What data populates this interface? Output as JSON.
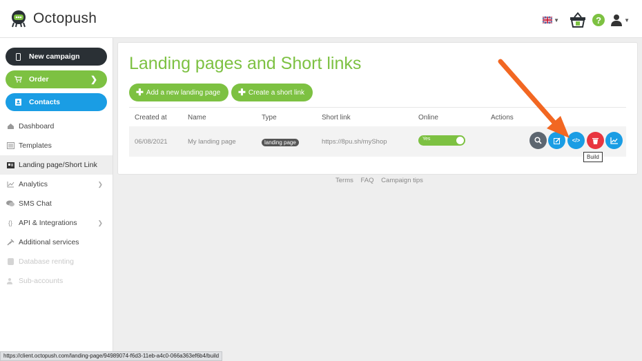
{
  "app": {
    "name": "Octopush"
  },
  "header": {
    "flag": "uk-flag",
    "basket_count": "0"
  },
  "sidebar": {
    "buttons": [
      {
        "label": "New campaign",
        "icon": "phone-icon"
      },
      {
        "label": "Order",
        "icon": "cart-icon"
      },
      {
        "label": "Contacts",
        "icon": "address-book-icon"
      }
    ],
    "items": [
      {
        "label": "Dashboard",
        "icon": "dashboard-icon"
      },
      {
        "label": "Templates",
        "icon": "template-icon"
      },
      {
        "label": "Landing page/Short Link",
        "icon": "landing-icon"
      },
      {
        "label": "Analytics",
        "icon": "chart-icon"
      },
      {
        "label": "SMS Chat",
        "icon": "chat-icon"
      },
      {
        "label": "API & Integrations",
        "icon": "code-icon"
      },
      {
        "label": "Additional services",
        "icon": "tools-icon"
      },
      {
        "label": "Database renting",
        "icon": "database-icon"
      },
      {
        "label": "Sub-accounts",
        "icon": "users-icon"
      }
    ]
  },
  "main": {
    "title": "Landing pages and Short links",
    "add_landing_label": "Add a new landing page",
    "create_short_label": "Create a short link",
    "table": {
      "headers": [
        "Created at",
        "Name",
        "Type",
        "Short link",
        "Online",
        "Actions"
      ],
      "rows": [
        {
          "created_at": "06/08/2021",
          "name": "My landing page",
          "type": "landing page",
          "short_link": "https://8pu.sh/myShop",
          "online": "Yes"
        }
      ]
    },
    "tooltip": "Build"
  },
  "footer": {
    "links": [
      "Terms",
      "FAQ",
      "Campaign tips"
    ]
  },
  "status_bar": {
    "url": "https://client.octopush.com/landing-page/94989074-f6d3-11eb-a4c0-066a363ef6b4/build"
  },
  "colors": {
    "green": "#7dc142",
    "blue": "#1a9de4",
    "dark": "#2a3035",
    "red": "#e8353f",
    "grey": "#5d6670",
    "arrow": "#f26722"
  }
}
